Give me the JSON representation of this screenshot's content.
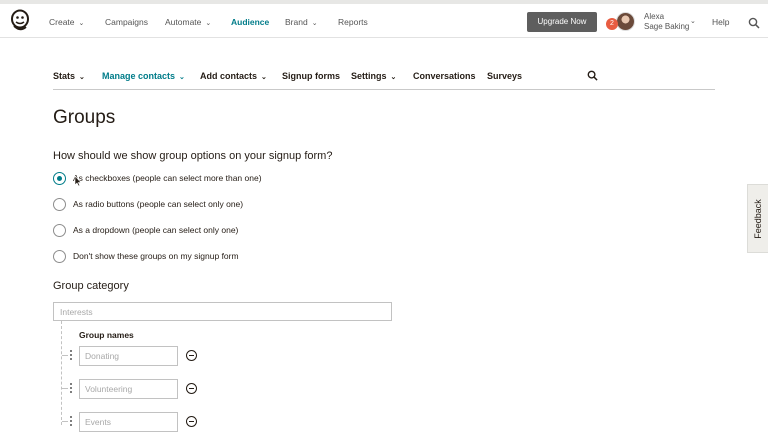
{
  "topnav": {
    "items": [
      {
        "label": "Create",
        "has_menu": true
      },
      {
        "label": "Campaigns",
        "has_menu": false
      },
      {
        "label": "Automate",
        "has_menu": true
      },
      {
        "label": "Audience",
        "has_menu": false,
        "active": true
      },
      {
        "label": "Brand",
        "has_menu": true
      },
      {
        "label": "Reports",
        "has_menu": false
      }
    ],
    "upgrade_label": "Upgrade Now",
    "notification_count": "2",
    "account_name": "Alexa",
    "account_org": "Sage Baking",
    "help_label": "Help"
  },
  "subnav": {
    "items": [
      {
        "label": "Stats",
        "has_menu": true
      },
      {
        "label": "Manage contacts",
        "has_menu": true,
        "active": true
      },
      {
        "label": "Add contacts",
        "has_menu": true
      },
      {
        "label": "Signup forms",
        "has_menu": false
      },
      {
        "label": "Settings",
        "has_menu": true
      },
      {
        "label": "Conversations",
        "has_menu": false
      },
      {
        "label": "Surveys",
        "has_menu": false
      }
    ]
  },
  "page": {
    "title": "Groups",
    "question": "How should we show group options on your signup form?",
    "options": [
      {
        "label": "As checkboxes (people can select more than one)",
        "selected": true
      },
      {
        "label": "As radio buttons (people can select only one)",
        "selected": false
      },
      {
        "label": "As a dropdown (people can select only one)",
        "selected": false
      },
      {
        "label": "Don't show these groups on my signup form",
        "selected": false
      }
    ],
    "category_label": "Group category",
    "category_placeholder": "Interests",
    "group_names_label": "Group names",
    "groups": [
      {
        "placeholder": "Donating"
      },
      {
        "placeholder": "Volunteering"
      },
      {
        "placeholder": "Events"
      }
    ]
  },
  "feedback_label": "Feedback",
  "colors": {
    "accent": "#007c89",
    "upgrade_button": "#5e5e5e",
    "badge": "#e85c41"
  }
}
